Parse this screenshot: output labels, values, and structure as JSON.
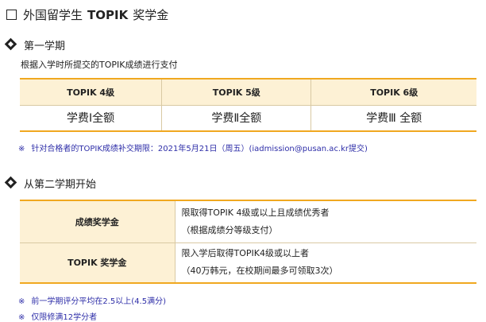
{
  "header": {
    "title_prefix": "外国留学生",
    "title_strong": "TOPIK",
    "title_suffix": "奖学金"
  },
  "section1": {
    "title": "第一学期",
    "desc": "根据入学时所提交的TOPIK成绩进行支付",
    "columns": [
      "TOPIK 4级",
      "TOPIK 5级",
      "TOPIK 6级"
    ],
    "values": [
      "学费Ⅰ全额",
      "学费Ⅱ全额",
      "学费Ⅲ 全额"
    ],
    "note_mark": "※",
    "note": "针对合格者的TOPIK成绩补交期限：2021年5月21日（周五）(iadmission@pusan.ac.kr提交)"
  },
  "section2": {
    "title": "从第二学期开始",
    "rows": [
      {
        "label": "成绩奖学金",
        "line1": "限取得TOPIK 4级或以上且成绩优秀者",
        "line2": "（根据成绩分等级支付）"
      },
      {
        "label": "TOPIK 奖学金",
        "line1": "限入学后取得TOPIK4级或以上者",
        "line2": "（40万韩元，在校期间最多可领取3次）"
      }
    ],
    "notes": [
      "前一学期评分平均在2.5以上(4.5满分)",
      "仅限修满12学分者"
    ],
    "note_mark": "※"
  }
}
